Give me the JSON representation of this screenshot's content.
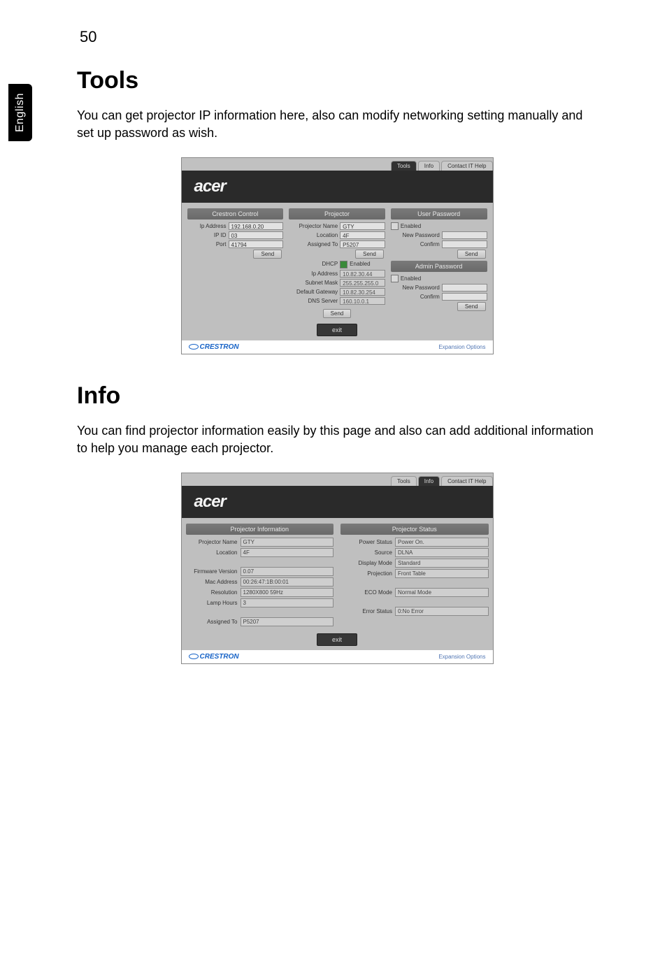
{
  "page_number": "50",
  "side_tab": "English",
  "sections": {
    "tools": {
      "heading": "Tools",
      "desc": "You can get projector IP information here, also can modify networking setting manually and set up password as wish."
    },
    "info": {
      "heading": "Info",
      "desc": "You can find projector information easily by this page and also can add additional information to help you manage each projector."
    }
  },
  "common": {
    "brand": "acer",
    "tabs": {
      "tools": "Tools",
      "info": "Info",
      "contact": "Contact IT Help"
    },
    "exit_label": "exit",
    "send_label": "Send",
    "enabled_label": "Enabled",
    "footer": {
      "crestron": "CRESTRON",
      "expansion": "Expansion Options"
    }
  },
  "tools_shot": {
    "crestron_control": {
      "title": "Crestron Control",
      "ip_address_label": "Ip Address",
      "ip_address": "192.168.0.20",
      "ip_id_label": "IP ID",
      "ip_id": "03",
      "port_label": "Port",
      "port": "41794"
    },
    "projector": {
      "title": "Projector",
      "name_label": "Projector Name",
      "name": "GTY",
      "location_label": "Location",
      "location": "4F",
      "assigned_label": "Assigned To",
      "assigned": "P5207",
      "dhcp_label": "DHCP",
      "ip_address_label": "Ip Address",
      "ip_address": "10.82.30.44",
      "subnet_label": "Subnet Mask",
      "subnet": "255.255.255.0",
      "gateway_label": "Default Gateway",
      "gateway": "10.82.30.254",
      "dns_label": "DNS Server",
      "dns": "160.10.0.1"
    },
    "user_pw": {
      "title": "User Password",
      "new_pw_label": "New Password",
      "confirm_label": "Confirm"
    },
    "admin_pw": {
      "title": "Admin Password",
      "new_pw_label": "New Password",
      "confirm_label": "Confirm"
    }
  },
  "info_shot": {
    "left_title": "Projector Information",
    "right_title": "Projector Status",
    "left": {
      "projector_name_label": "Projector Name",
      "projector_name": "GTY",
      "location_label": "Location",
      "location": "4F",
      "fw_label": "Firmware Version",
      "fw": "0.07",
      "mac_label": "Mac Address",
      "mac": "00:26:47:1B:00:01",
      "res_label": "Resolution",
      "res": "1280X800 59Hz",
      "lamp_label": "Lamp Hours",
      "lamp": "3",
      "assigned_label": "Assigned To",
      "assigned": "P5207"
    },
    "right": {
      "power_label": "Power Status",
      "power": "Power On.",
      "source_label": "Source",
      "source": "DLNA",
      "display_label": "Display Mode",
      "display": "Standard",
      "projection_label": "Projection",
      "projection": "Front Table",
      "eco_label": "ECO Mode",
      "eco": "Normal Mode",
      "error_label": "Error Status",
      "error": "0:No Error"
    }
  }
}
